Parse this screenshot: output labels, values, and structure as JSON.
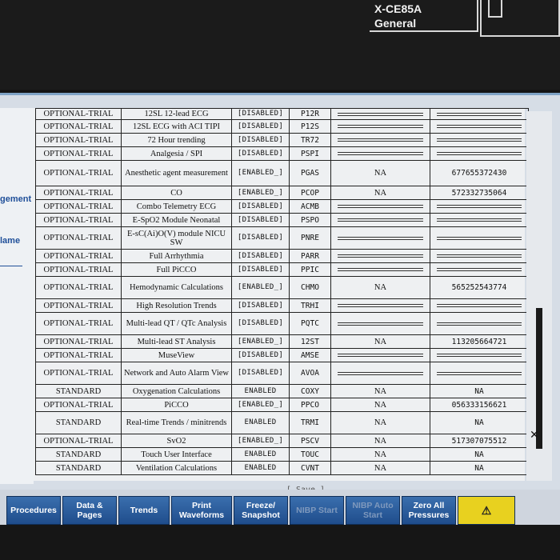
{
  "header": {
    "module_model": "X-CE85A",
    "module_profile": "General"
  },
  "side_labels": [
    "gement",
    "lame"
  ],
  "table": {
    "rows": [
      {
        "type": "OPTIONAL-TRIAL",
        "desc": "12SL 12-lead ECG",
        "status": "[DISABLED]",
        "code": "P12R",
        "left": "",
        "right": ""
      },
      {
        "type": "OPTIONAL-TRIAL",
        "desc": "12SL ECG with ACI TIPI",
        "status": "[DISABLED]",
        "code": "P12S",
        "left": "",
        "right": ""
      },
      {
        "type": "OPTIONAL-TRIAL",
        "desc": "72 Hour trending",
        "status": "[DISABLED]",
        "code": "TR72",
        "left": "",
        "right": ""
      },
      {
        "type": "OPTIONAL-TRIAL",
        "desc": "Analgesia / SPI",
        "status": "[DISABLED]",
        "code": "PSPI",
        "left": "",
        "right": ""
      },
      {
        "type": "OPTIONAL-TRIAL",
        "desc": "Anesthetic agent measurement",
        "status": "[ENABLED_]",
        "code": "PGAS",
        "left": "NA",
        "right": "677655372430"
      },
      {
        "type": "OPTIONAL-TRIAL",
        "desc": "CO",
        "status": "[ENABLED_]",
        "code": "PCOP",
        "left": "NA",
        "right": "572332735064"
      },
      {
        "type": "OPTIONAL-TRIAL",
        "desc": "Combo Telemetry ECG",
        "status": "[DISABLED]",
        "code": "ACMB",
        "left": "",
        "right": ""
      },
      {
        "type": "OPTIONAL-TRIAL",
        "desc": "E-SpO2 Module Neonatal",
        "status": "[DISABLED]",
        "code": "PSPO",
        "left": "",
        "right": ""
      },
      {
        "type": "OPTIONAL-TRIAL",
        "desc": "E-sC(Ai)O(V) module NICU SW",
        "status": "[DISABLED]",
        "code": "PNRE",
        "left": "",
        "right": ""
      },
      {
        "type": "OPTIONAL-TRIAL",
        "desc": "Full Arrhythmia",
        "status": "[DISABLED]",
        "code": "PARR",
        "left": "",
        "right": ""
      },
      {
        "type": "OPTIONAL-TRIAL",
        "desc": "Full PiCCO",
        "status": "[DISABLED]",
        "code": "PPIC",
        "left": "",
        "right": ""
      },
      {
        "type": "OPTIONAL-TRIAL",
        "desc": "Hemodynamic Calculations",
        "status": "[ENABLED_]",
        "code": "CHMO",
        "left": "NA",
        "right": "565252543774"
      },
      {
        "type": "OPTIONAL-TRIAL",
        "desc": "High Resolution Trends",
        "status": "[DISABLED]",
        "code": "TRHI",
        "left": "",
        "right": ""
      },
      {
        "type": "OPTIONAL-TRIAL",
        "desc": "Multi-lead QT / QTc Analysis",
        "status": "[DISABLED]",
        "code": "PQTC",
        "left": "",
        "right": ""
      },
      {
        "type": "OPTIONAL-TRIAL",
        "desc": "Multi-lead ST Analysis",
        "status": "[ENABLED_]",
        "code": "12ST",
        "left": "NA",
        "right": "113205664721"
      },
      {
        "type": "OPTIONAL-TRIAL",
        "desc": "MuseView",
        "status": "[DISABLED]",
        "code": "AMSE",
        "left": "",
        "right": ""
      },
      {
        "type": "OPTIONAL-TRIAL",
        "desc": "Network and Auto Alarm View",
        "status": "[DISABLED]",
        "code": "AVOA",
        "left": "",
        "right": ""
      },
      {
        "type": "STANDARD",
        "desc": "Oxygenation Calculations",
        "status": "ENABLED",
        "code": "COXY",
        "left": "NA",
        "right": "NA"
      },
      {
        "type": "OPTIONAL-TRIAL",
        "desc": "PiCCO",
        "status": "[ENABLED_]",
        "code": "PPCO",
        "left": "NA",
        "right": "056333156621"
      },
      {
        "type": "STANDARD",
        "desc": "Real-time Trends / minitrends",
        "status": "ENABLED",
        "code": "TRMI",
        "left": "NA",
        "right": "NA"
      },
      {
        "type": "OPTIONAL-TRIAL",
        "desc": "SvO2",
        "status": "[ENABLED_]",
        "code": "PSCV",
        "left": "NA",
        "right": "517307075512"
      },
      {
        "type": "STANDARD",
        "desc": "Touch User Interface",
        "status": "ENABLED",
        "code": "TOUC",
        "left": "NA",
        "right": "NA"
      },
      {
        "type": "STANDARD",
        "desc": "Ventilation Calculations",
        "status": "ENABLED",
        "code": "CVNT",
        "left": "NA",
        "right": "NA"
      }
    ],
    "save_label": "[ Save ]"
  },
  "softkeys": [
    {
      "label": "Procedures",
      "enabled": true
    },
    {
      "label": "Data & Pages",
      "enabled": true
    },
    {
      "label": "Trends",
      "enabled": true
    },
    {
      "label": "Print Waveforms",
      "enabled": true
    },
    {
      "label": "Freeze/ Snapshot",
      "enabled": true
    },
    {
      "label": "NIBP Start",
      "enabled": false
    },
    {
      "label": "NIBP Auto Start",
      "enabled": false
    },
    {
      "label": "Zero All Pressures",
      "enabled": true
    },
    {
      "label": "⚠",
      "enabled": true
    }
  ],
  "icons": {
    "alarm": "alarm-bell-icon",
    "scroll_close": "close-icon"
  },
  "colors": {
    "accent": "#2b5fa3",
    "alarm": "#e8d11f",
    "screen": "#d6dde6"
  }
}
